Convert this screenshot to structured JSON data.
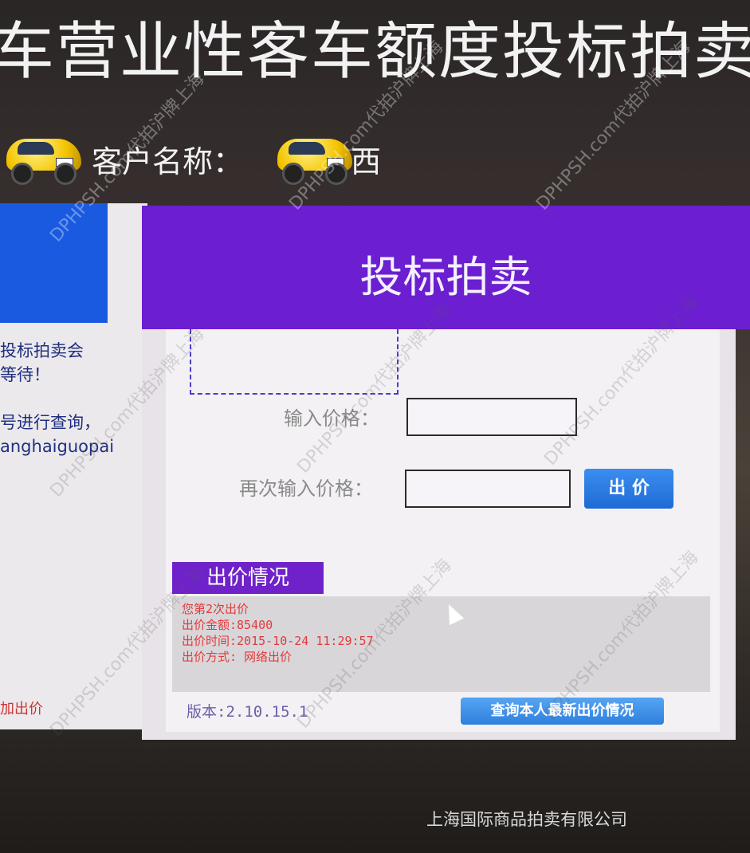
{
  "header": {
    "title": "车营业性客车额度投标拍卖",
    "customer_label": "客户名称：",
    "customer_value": "",
    "customer_suffix": "西"
  },
  "left_panel": {
    "text": "投标拍卖会\n等待！\n\n号进行查询，\nanghaiguopai",
    "note": "加出价"
  },
  "bid_panel": {
    "title": "投标拍卖",
    "price_label": "输入价格：",
    "repeat_price_label": "再次输入价格：",
    "price_value": "",
    "repeat_price_value": "",
    "submit_label": "出 价",
    "status_tab": "出价情况",
    "status_lines": [
      "您第2次出价",
      "出价金额:85400",
      "出价时间:2015-10-24 11:29:57",
      "出价方式: 网络出价"
    ],
    "version": "版本:2.10.15.1",
    "query_label": "查询本人最新出价情况"
  },
  "footer": {
    "company": "上海国际商品拍卖有限公司"
  },
  "watermarks": {
    "text": "DPHPSH.com代拍沪牌上海"
  },
  "colors": {
    "header_purple": "#6b1fd0",
    "status_red": "#e23a3a",
    "button_blue": "#1f6ad6",
    "panel_blue": "#1a5ae0"
  }
}
